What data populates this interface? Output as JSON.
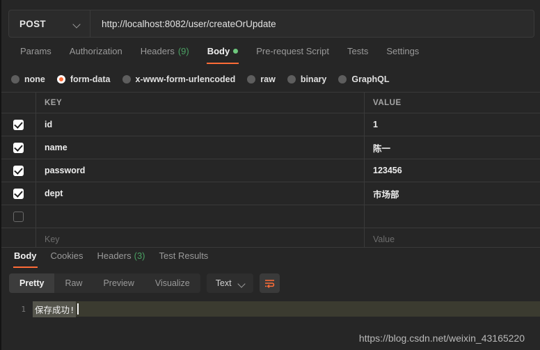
{
  "request": {
    "method": "POST",
    "method_chevron_icon": "chevron-down-icon",
    "url": "http://localhost:8082/user/createOrUpdate",
    "url_placeholder": "Enter request URL",
    "tabs": [
      {
        "label": "Params",
        "active": false
      },
      {
        "label": "Authorization",
        "active": false
      },
      {
        "label": "Headers",
        "count": "(9)",
        "active": false
      },
      {
        "label": "Body",
        "active": true,
        "dot": true
      },
      {
        "label": "Pre-request Script",
        "active": false
      },
      {
        "label": "Tests",
        "active": false
      },
      {
        "label": "Settings",
        "active": false
      }
    ],
    "body_types": [
      {
        "label": "none",
        "selected": false
      },
      {
        "label": "form-data",
        "selected": true
      },
      {
        "label": "x-www-form-urlencoded",
        "selected": false
      },
      {
        "label": "raw",
        "selected": false
      },
      {
        "label": "binary",
        "selected": false
      },
      {
        "label": "GraphQL",
        "selected": false
      }
    ]
  },
  "form_table": {
    "columns": {
      "key": "KEY",
      "value": "VALUE"
    },
    "rows": [
      {
        "checked": true,
        "key": "id",
        "value": "1"
      },
      {
        "checked": true,
        "key": "name",
        "value": "陈一"
      },
      {
        "checked": true,
        "key": "password",
        "value": "123456"
      },
      {
        "checked": true,
        "key": "dept",
        "value": "市场部"
      },
      {
        "checked": false,
        "key": "",
        "value": ""
      }
    ],
    "placeholder_row": {
      "key": "Key",
      "value": "Value"
    }
  },
  "response": {
    "tabs": [
      {
        "label": "Body",
        "active": true
      },
      {
        "label": "Cookies",
        "active": false
      },
      {
        "label": "Headers",
        "count": "(3)",
        "active": false
      },
      {
        "label": "Test Results",
        "active": false
      }
    ],
    "view_modes": [
      {
        "label": "Pretty",
        "active": true
      },
      {
        "label": "Raw",
        "active": false
      },
      {
        "label": "Preview",
        "active": false
      },
      {
        "label": "Visualize",
        "active": false
      }
    ],
    "format_select": {
      "value": "Text",
      "chevron_icon": "chevron-down-icon"
    },
    "wrap_button_icon": "word-wrap-icon",
    "body": {
      "line_number": "1",
      "text": "保存成功!"
    }
  },
  "watermark": "https://blog.csdn.net/weixin_43165220",
  "colors": {
    "accent": "#ff6c37",
    "success": "#6ec77d",
    "count": "#4aa163",
    "app_bg": "#262626",
    "line_highlight": "#3b3b30",
    "selection": "#55554c"
  }
}
